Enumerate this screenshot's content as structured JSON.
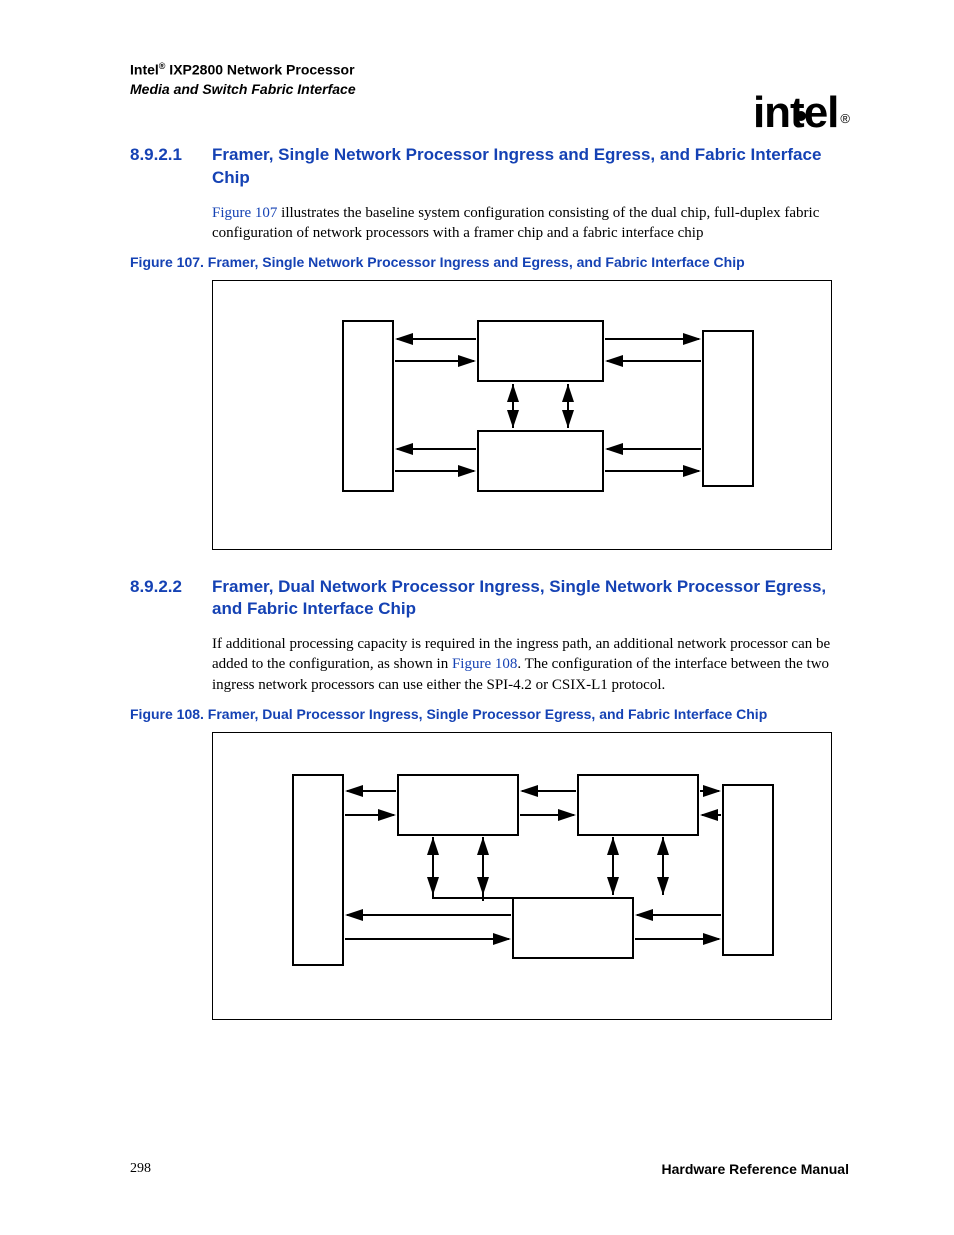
{
  "header": {
    "brand": "Intel",
    "reg": "®",
    "product": " IXP2800 Network Processor",
    "subtitle": "Media and Switch Fabric Interface"
  },
  "logo": {
    "text_a": "int",
    "text_b": "el",
    "reg": "®"
  },
  "section1": {
    "num": "8.9.2.1",
    "title": "Framer, Single Network Processor Ingress and Egress, and Fabric Interface Chip",
    "para_ref": "Figure 107",
    "para_rest": " illustrates the baseline system configuration consisting of the dual chip, full-duplex fabric configuration of network processors with a framer chip and a fabric interface chip",
    "fig_caption": "Figure 107. Framer, Single Network Processor Ingress and Egress, and Fabric Interface Chip"
  },
  "section2": {
    "num": "8.9.2.2",
    "title": "Framer, Dual Network Processor Ingress, Single Network Processor Egress, and Fabric Interface Chip",
    "para_a": "If additional processing capacity is required in the ingress path, an additional network processor can be added to the configuration, as shown in ",
    "para_ref": "Figure 108",
    "para_b": ". The configuration of the interface between the two ingress network processors can use either the SPI-4.2 or CSIX-L1 protocol.",
    "fig_caption": "Figure 108. Framer, Dual Processor Ingress, Single Processor Egress, and Fabric Interface Chip"
  },
  "footer": {
    "page": "298",
    "doc": "Hardware Reference Manual"
  }
}
